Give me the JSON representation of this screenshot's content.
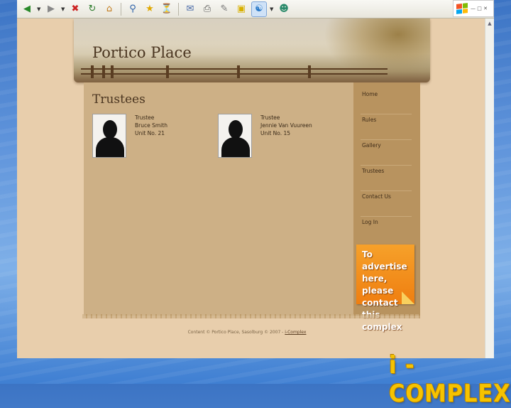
{
  "toolbar": {
    "buttons": [
      "back-icon",
      "forward-icon",
      "stop-icon",
      "refresh-icon",
      "home-icon",
      "search-icon",
      "favorites-icon",
      "history-icon",
      "mail-icon",
      "print-icon",
      "edit-icon",
      "discuss-icon",
      "messenger-icon",
      "research-icon"
    ]
  },
  "site": {
    "title": "Portico Place"
  },
  "content": {
    "title": "Trustees",
    "trustees": [
      {
        "role": "Trustee",
        "name": "Bruce Smith",
        "unit": "Unit No. 21"
      },
      {
        "role": "Trustee",
        "name": "Jennie Van Vuureen",
        "unit": "Unit No. 15"
      }
    ]
  },
  "nav": {
    "items": [
      "Home",
      "Rules",
      "Gallery",
      "Trustees",
      "Contact Us",
      "Log In"
    ]
  },
  "ad": {
    "text": "To advertise here, please contact this complex"
  },
  "footer": {
    "text": "Content © Portico Place, Sasolburg © 2007 -",
    "link": "i-Complex"
  },
  "brand": {
    "text": "i - COMPLEX"
  },
  "colors": {
    "page_bg": "#e8ceac",
    "content_bg": "#cdb086",
    "sidebar_bg": "#b8935f",
    "ad_orange": "#ef7e10",
    "brand_yellow": "#f6c300",
    "desktop_blue": "#5d92da"
  }
}
